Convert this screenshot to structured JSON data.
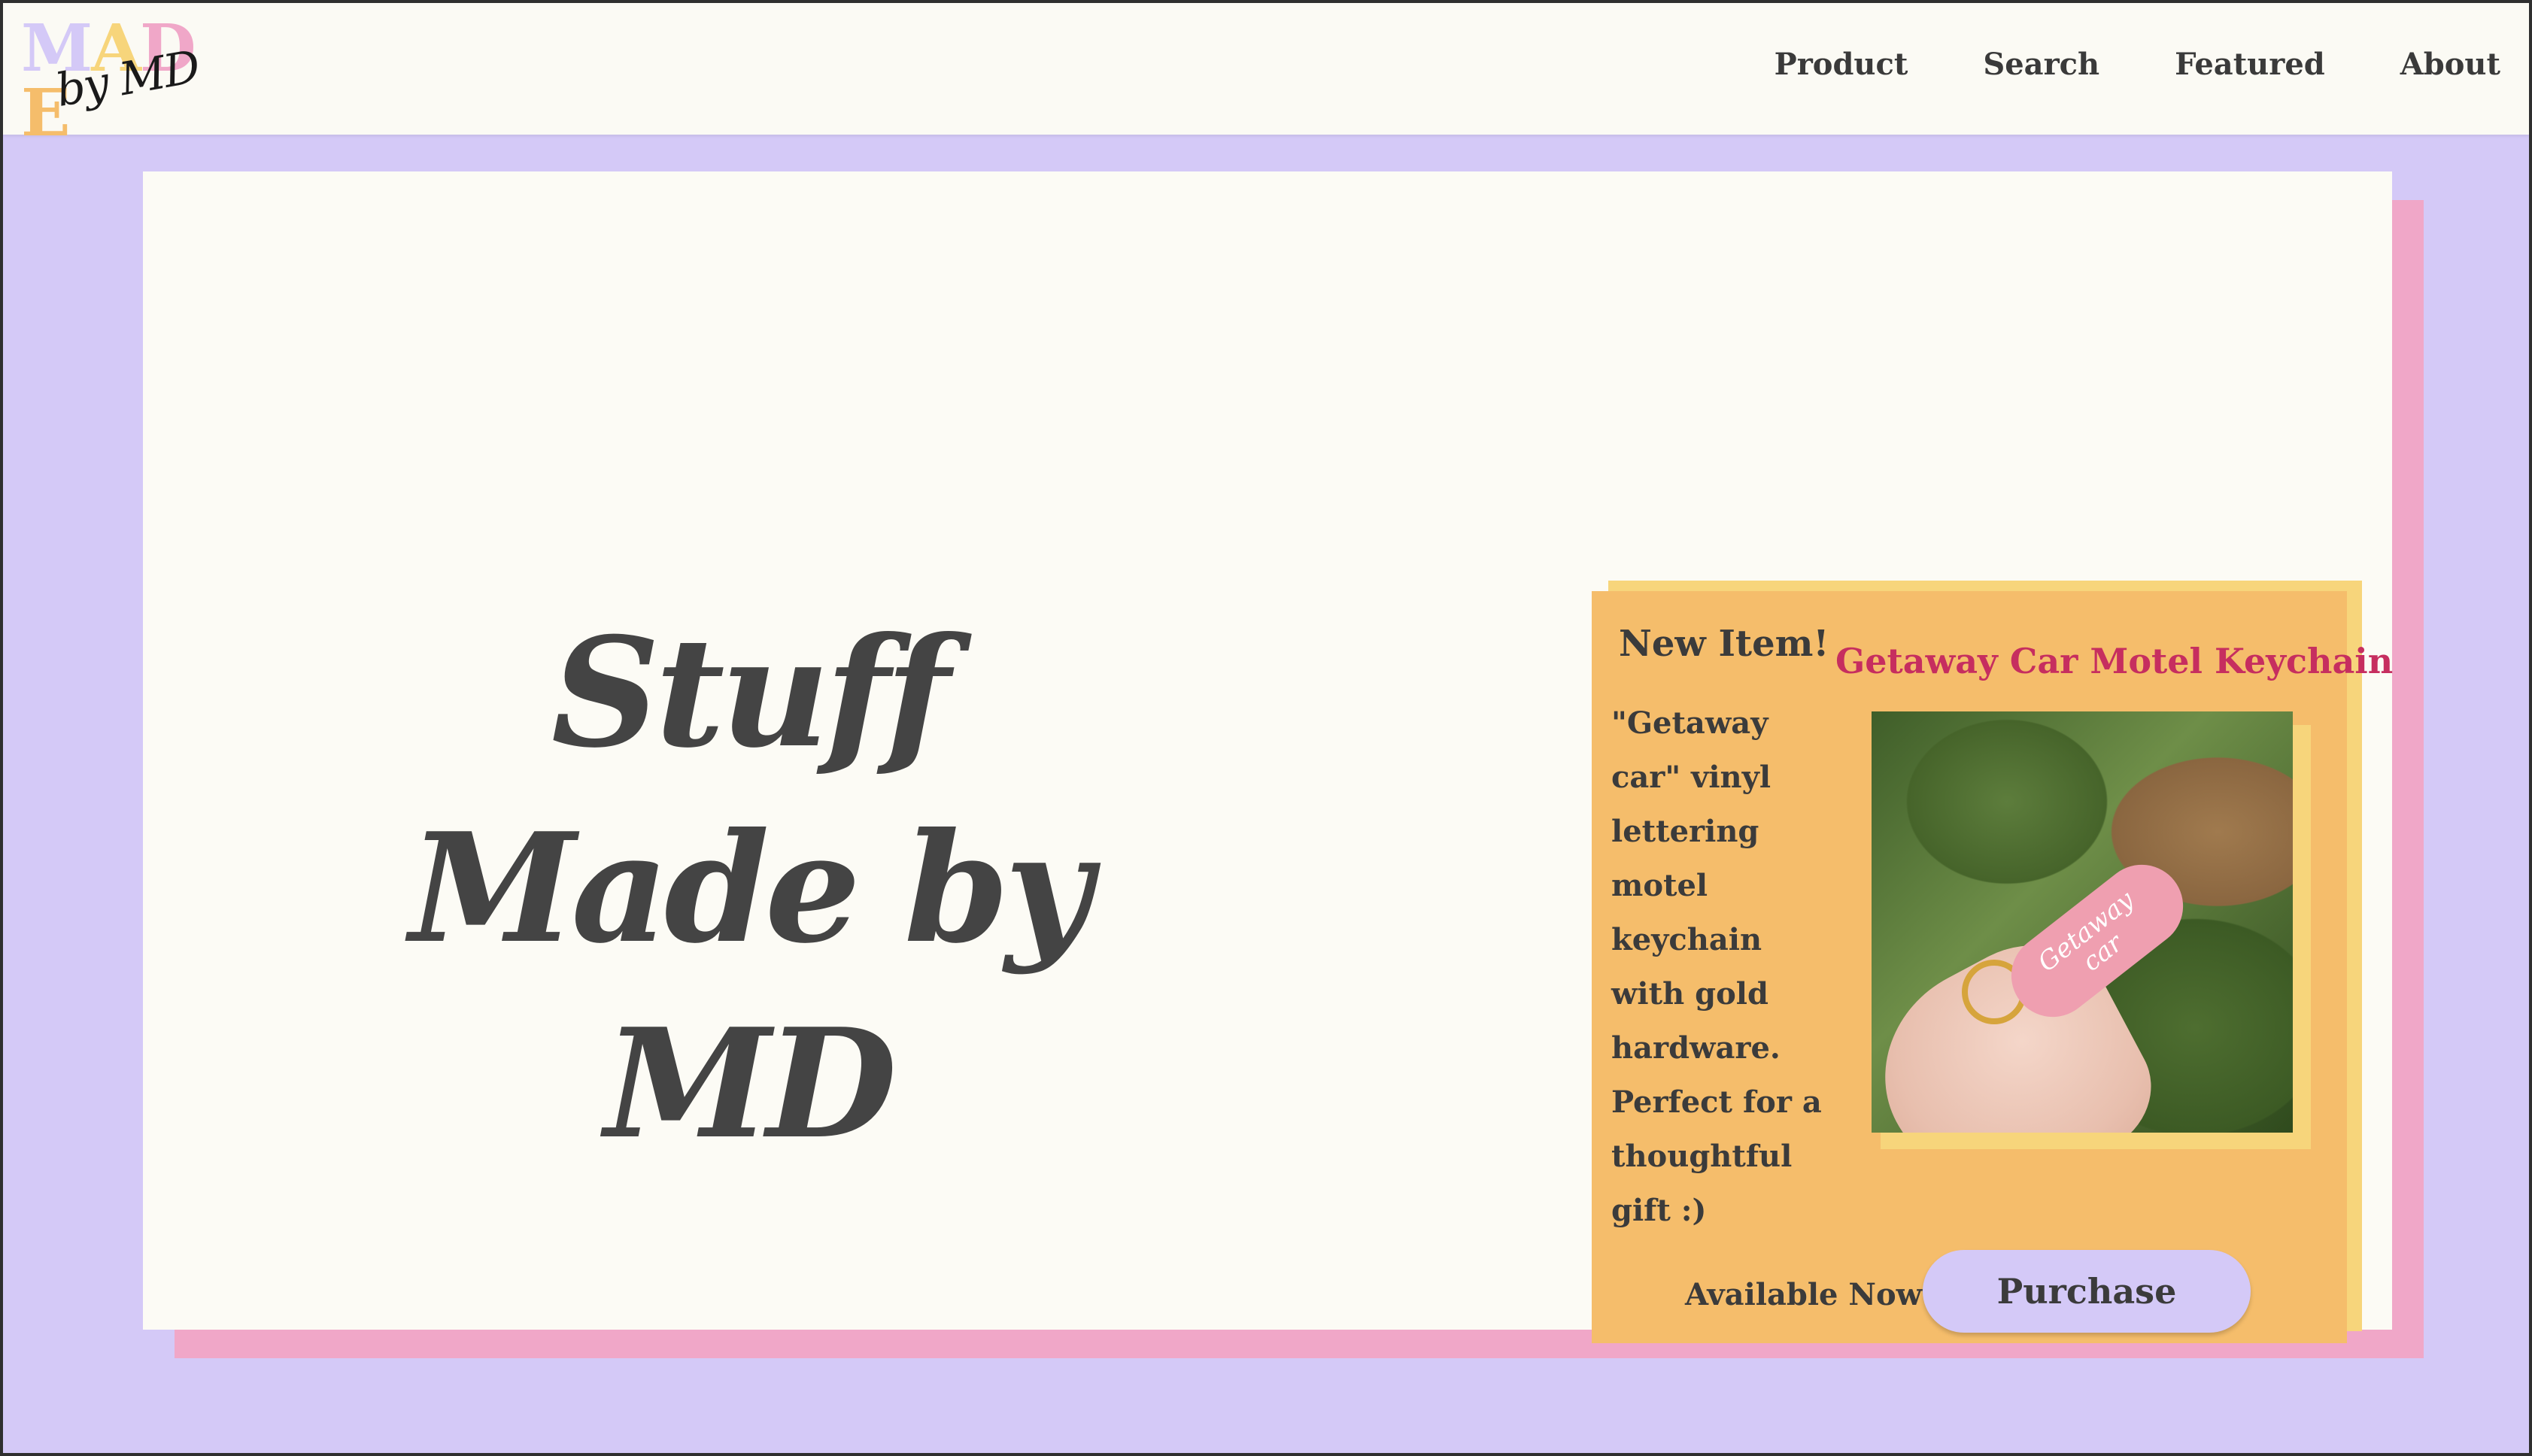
{
  "header": {
    "logo": {
      "word": [
        "M",
        "A",
        "D",
        "E"
      ],
      "colors": [
        "#d4c9f7",
        "#f7d57b",
        "#f0a7c8",
        "#f5bd6b"
      ],
      "byline": "by MD"
    },
    "nav": [
      "Product",
      "Search",
      "Featured",
      "About"
    ]
  },
  "hero": {
    "title": "Stuff Made by MD"
  },
  "featured": {
    "badge": "New Item!",
    "title": "Getaway Car Motel Keychain",
    "description": "\"Getaway car\" vinyl lettering motel keychain with gold hardware. Perfect for a thoughtful gift :)",
    "keychain_text": "Getaway car",
    "availability": "Available Now!",
    "cta": "Purchase"
  },
  "colors": {
    "background": "#d4c9f7",
    "card": "#fcfbf5",
    "shadow": "#f0a7c8",
    "panel": "#f5bd6b",
    "panel_accent": "#f7d57b",
    "title_accent": "#c62e5f"
  }
}
